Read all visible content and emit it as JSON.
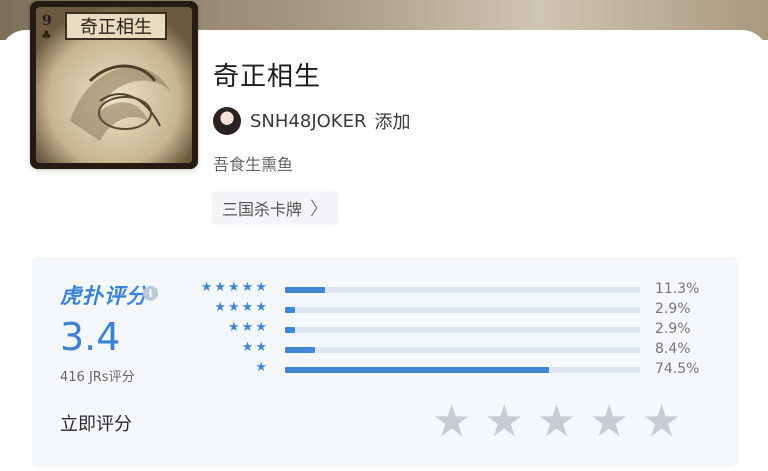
{
  "book": {
    "cover_title": "奇正相生",
    "title": "奇正相生",
    "author": "SNH48JOKER",
    "add_label": "添加",
    "description": "吾食生熏鱼",
    "tag": "三国杀卡牌",
    "tag_chevron": "〉"
  },
  "rating": {
    "brand": "虎扑评分",
    "brand_mark": "®",
    "info_icon": "i",
    "score": "3.4",
    "count_label": "416 JRs评分",
    "rate_now_label": "立即评分",
    "distribution": [
      {
        "stars": "★★★★★",
        "value": 11.3,
        "label": "11.3%"
      },
      {
        "stars": "★★★★",
        "value": 2.9,
        "label": "2.9%"
      },
      {
        "stars": "★★★",
        "value": 2.9,
        "label": "2.9%"
      },
      {
        "stars": "★★",
        "value": 8.4,
        "label": "8.4%"
      },
      {
        "stars": "★",
        "value": 74.5,
        "label": "74.5%"
      }
    ],
    "rate_star_glyph": "★"
  },
  "colors": {
    "accent": "#3a82d6",
    "bar_track": "#dde7f3",
    "panel": "#f4f8fd",
    "star_empty": "#c7cbd3"
  }
}
